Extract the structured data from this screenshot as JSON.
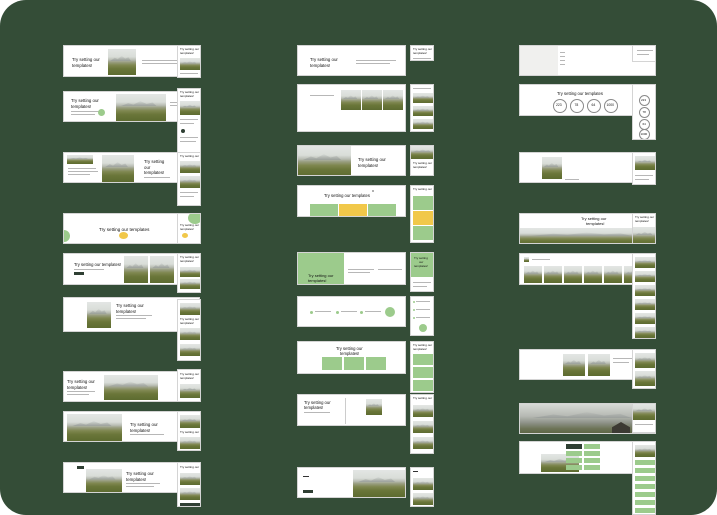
{
  "workspace": {
    "background": "#344d37",
    "accent_green": "#9ccb8c",
    "accent_yellow": "#f1c84a"
  },
  "templates": {
    "heading": "Try setting our templates!",
    "heading_short": "Try setting our templates",
    "heading_line1": "Try setting",
    "heading_line2": "our",
    "heading_line3": "templates!",
    "heading_part_a": "Try setting our",
    "heading_part_b": "templates!",
    "stats": [
      "223",
      "78",
      "64",
      "1000"
    ],
    "mobile_stats": [
      "223",
      "78",
      "64",
      "1000"
    ]
  }
}
